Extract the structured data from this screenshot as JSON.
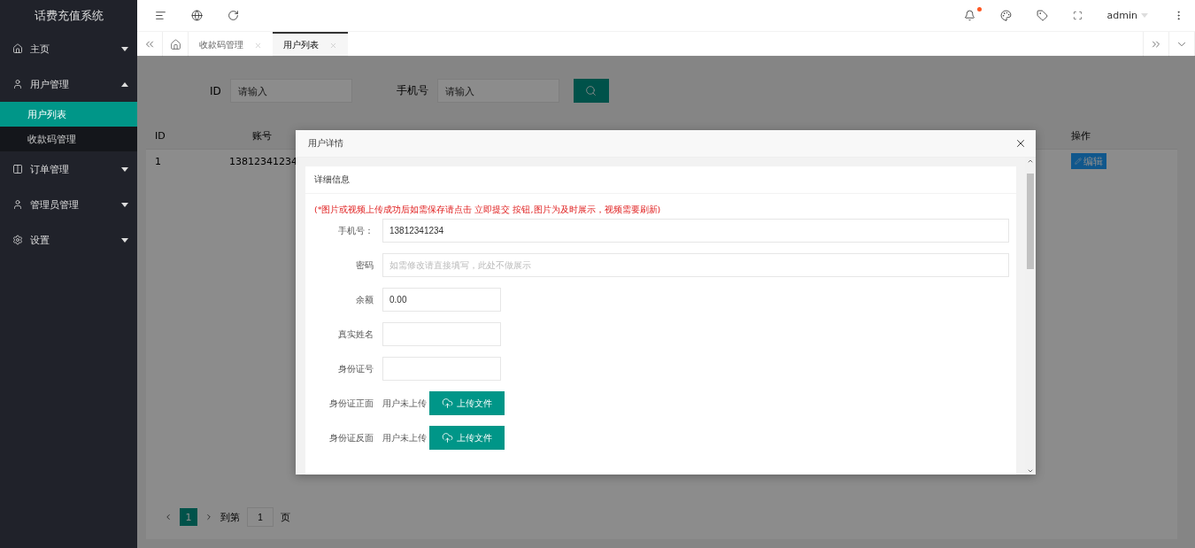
{
  "sidebar": {
    "title": "话费充值系统",
    "items": [
      {
        "label": "主页",
        "expanded": false
      },
      {
        "label": "用户管理",
        "expanded": true,
        "children": [
          {
            "label": "用户列表",
            "selected": true
          },
          {
            "label": "收款码管理",
            "selected": false
          }
        ]
      },
      {
        "label": "订单管理",
        "expanded": false
      },
      {
        "label": "管理员管理",
        "expanded": false
      },
      {
        "label": "设置",
        "expanded": false
      }
    ]
  },
  "header": {
    "user": "admin",
    "notification": true
  },
  "tabs": [
    {
      "label": "收款码管理",
      "selected": false
    },
    {
      "label": "用户列表",
      "selected": true
    }
  ],
  "filters": [
    {
      "label": "ID",
      "placeholder": "请输入"
    },
    {
      "label": "手机号",
      "placeholder": "请输入"
    }
  ],
  "table": {
    "columns": [
      "ID",
      "账号",
      "操作"
    ],
    "rows": [
      {
        "cells": [
          "1",
          "13812341234"
        ],
        "action": "编辑"
      }
    ]
  },
  "pagination": {
    "pages": [
      {
        "label": "1",
        "selected": true
      }
    ],
    "goto_label": "到第",
    "goto_value": "1",
    "unit": "页"
  },
  "modal": {
    "title": "用户详情",
    "card_title": "详细信息",
    "notice": "(*图片或视频上传成功后如需保存请点击 立即提交 按钮,图片为及时展示，视频需要刷新)",
    "fields": [
      {
        "kind": "wide",
        "label": "手机号：",
        "value": "13812341234"
      },
      {
        "kind": "wide",
        "label": "密码",
        "placeholder": "如需修改请直接填写，此处不做展示"
      },
      {
        "kind": "short",
        "label": "余额",
        "value": "0.00"
      },
      {
        "kind": "short",
        "label": "真实姓名"
      },
      {
        "kind": "short",
        "label": "身份证号"
      },
      {
        "kind": "upload",
        "label": "身份证正面",
        "status": "用户未上传",
        "button": "上传文件"
      },
      {
        "kind": "upload",
        "label": "身份证反面",
        "status": "用户未上传",
        "button": "上传文件"
      }
    ]
  }
}
